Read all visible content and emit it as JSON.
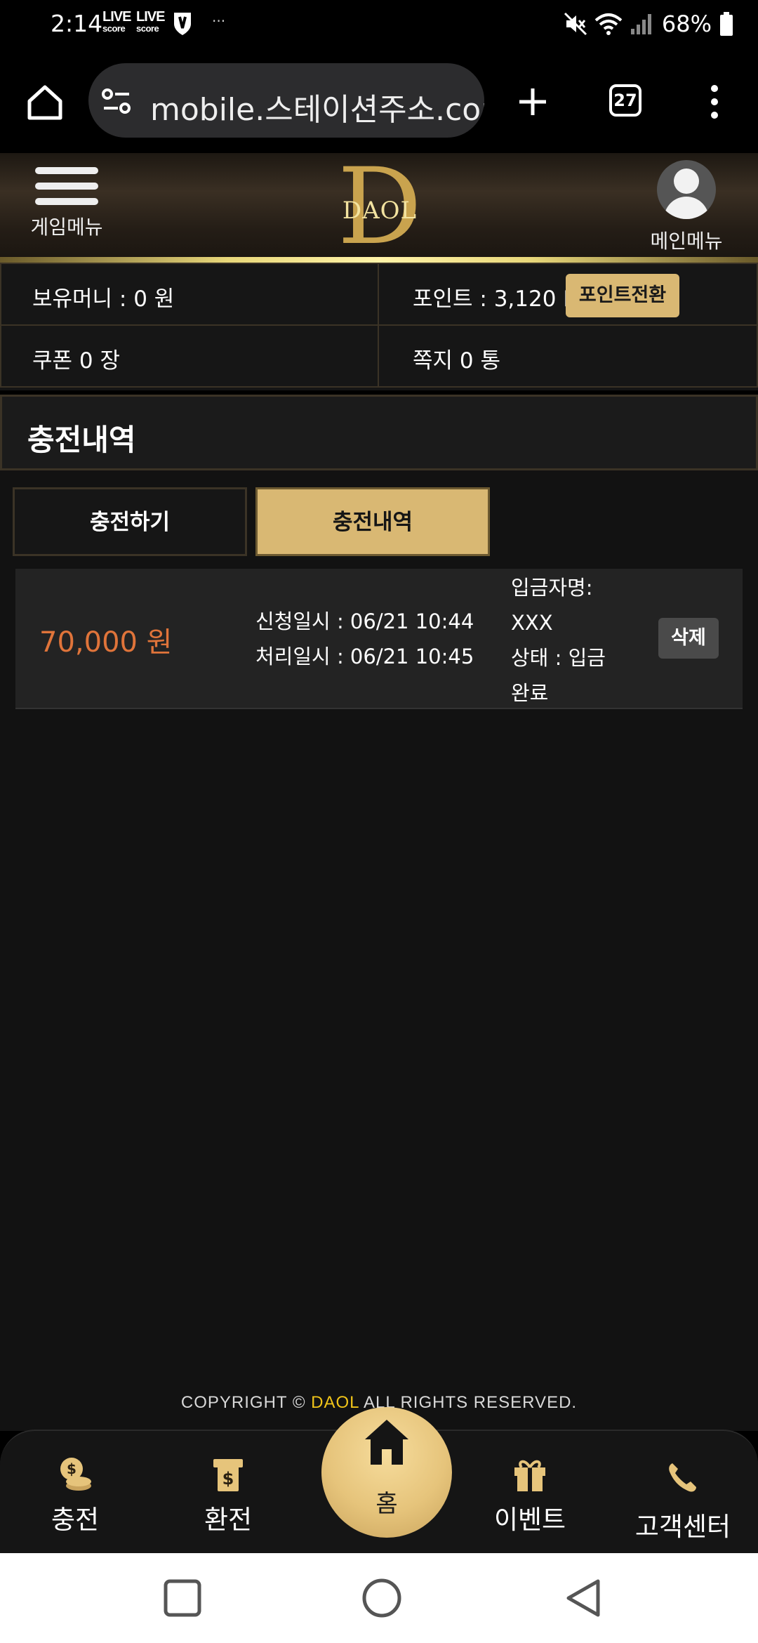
{
  "status_bar": {
    "time": "2:14",
    "live1_top": "LIVE",
    "live1_bottom": "score",
    "live2_top": "LIVE",
    "live2_bottom": "score",
    "more": "···",
    "battery": "68%"
  },
  "browser": {
    "url": "mobile.스테이션주소.com",
    "tab_count": "27"
  },
  "header": {
    "game_menu_label": "게임메뉴",
    "logo_text": "DAOL",
    "main_menu_label": "메인메뉴"
  },
  "info": {
    "balance": "보유머니 : 0 원",
    "points": "포인트 : 3,120 P",
    "convert_button": "포인트전환",
    "coupon": "쿠폰 0 장",
    "messages": "쪽지 0 통"
  },
  "section_title": "충전내역",
  "tabs": [
    {
      "label": "충전하기",
      "active": false
    },
    {
      "label": "충전내역",
      "active": true
    }
  ],
  "record": {
    "amount": "70,000 원",
    "requested": "신청일시 : 06/21 10:44",
    "processed": "처리일시 : 06/21 10:45",
    "depositor_label": "입금자명:",
    "depositor": "XXX",
    "status_line1": "상태 : 입금",
    "status_line2": "완료",
    "delete_button": "삭제"
  },
  "footer": {
    "copyright_prefix": "COPYRIGHT © ",
    "brand": "DAOL",
    "copyright_suffix": " ALL RIGHTS RESERVED."
  },
  "bottom_nav": {
    "charge": "충전",
    "exchange": "환전",
    "home": "홈",
    "event": "이벤트",
    "support": "고객센터"
  },
  "colors": {
    "gold": "#d9b873",
    "amount": "#e0743a",
    "brand_yellow": "#f0c419"
  }
}
